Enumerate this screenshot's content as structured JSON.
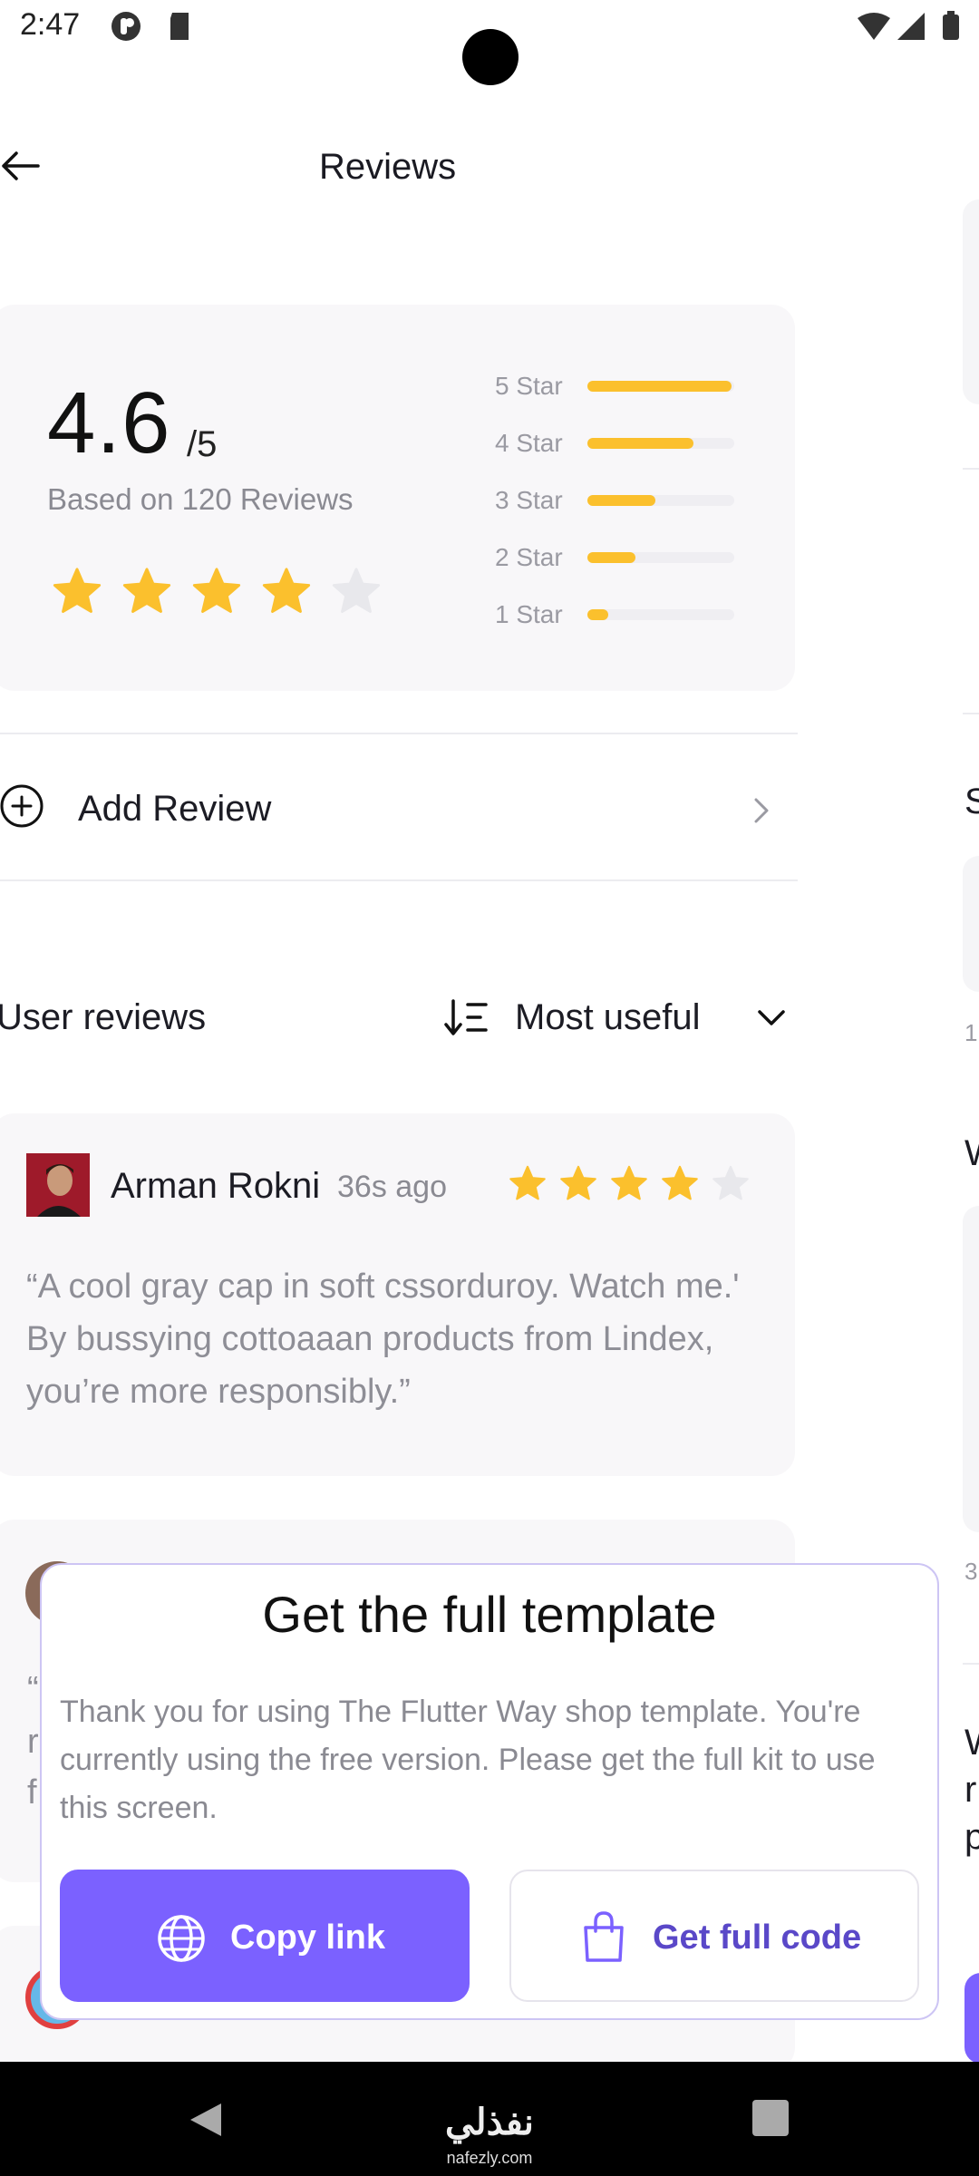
{
  "status_bar": {
    "time": "2:47",
    "icons": [
      "pinterest-icon",
      "sd-card-icon",
      "wifi-icon",
      "signal-icon",
      "battery-icon"
    ]
  },
  "header": {
    "title": "Reviews"
  },
  "rating_summary": {
    "score": "4.6",
    "max": "/5",
    "based_on": "Based on 120 Reviews",
    "stars_filled": 4,
    "stars_total": 5,
    "distribution": [
      {
        "label": "5 Star",
        "fraction": 0.98
      },
      {
        "label": "4 Star",
        "fraction": 0.72
      },
      {
        "label": "3 Star",
        "fraction": 0.46
      },
      {
        "label": "2 Star",
        "fraction": 0.33
      },
      {
        "label": "1 Star",
        "fraction": 0.14
      }
    ]
  },
  "add_review": {
    "label": "Add Review"
  },
  "user_reviews": {
    "title": "User reviews",
    "sort_label": "Most useful"
  },
  "review": {
    "name": "Arman Rokni",
    "time": "36s ago",
    "rating": 4,
    "text": "“A cool gray cap in soft cssorduroy. Watch me.' By bussying cottoaaan products from Lindex, you’re  more responsibly.”"
  },
  "review_peek": {
    "line1": "“",
    "line2": "r",
    "line3": "f"
  },
  "right_peek": {
    "letter_s": "S",
    "small_1": "1(",
    "letter_w": "W",
    "small_3": "3",
    "line_w": "W",
    "line_r": "r",
    "line_p": "p"
  },
  "modal": {
    "title": "Get the full template",
    "body": "Thank you for using The Flutter Way shop template. You're currently using the free version. Please get the full kit to use this screen.",
    "copy_button": "Copy link",
    "full_button": "Get full code"
  },
  "watermark": {
    "arabic": "نفذلي",
    "domain": "nafezly.com"
  },
  "colors": {
    "accent": "#7b61ff",
    "star": "#fbc02d",
    "star_empty": "#e8e8ec"
  }
}
